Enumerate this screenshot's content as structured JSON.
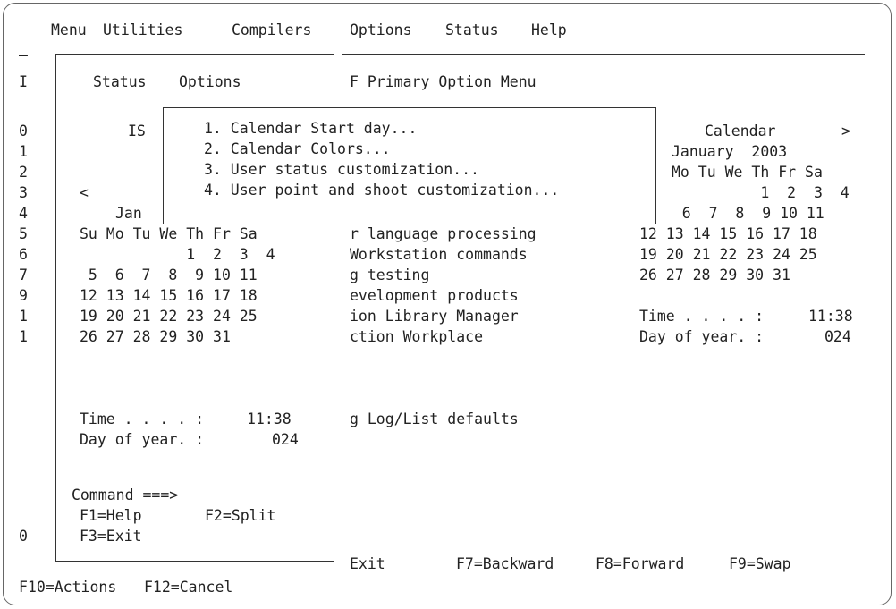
{
  "menubar": {
    "items": [
      "Menu",
      "Utilities",
      "Compilers",
      "Options",
      "Status",
      "Help"
    ]
  },
  "left_gutter": {
    "rows": [
      {
        "text": "—"
      },
      {
        "text": "I"
      },
      {
        "text": "0"
      },
      {
        "text": "1"
      },
      {
        "text": "2"
      },
      {
        "text": "3"
      },
      {
        "text": "4"
      },
      {
        "text": "5"
      },
      {
        "text": "6"
      },
      {
        "text": "7"
      },
      {
        "text": "9"
      },
      {
        "text": "1"
      },
      {
        "text": "1"
      },
      {
        "text": "0"
      }
    ]
  },
  "status_panel": {
    "menu_status": "Status",
    "menu_options": "Options",
    "is_text": "IS",
    "prev_arrow": "<",
    "month_abbrev": "Jan",
    "weekday_header": "Su Mo Tu We Th Fr Sa",
    "weeks": [
      "            1  2  3  4",
      " 5  6  7  8  9 10 11",
      "12 13 14 15 16 17 18",
      "19 20 21 22 23 24 25",
      "26 27 28 29 30 31"
    ],
    "time_label": "Time . . . . :",
    "time_value": "11:38",
    "doy_label": "Day of year. :",
    "doy_value": "024",
    "command_label": "Command ===>",
    "f1": "F1=Help",
    "f2": "F2=Split",
    "f3": "F3=Exit"
  },
  "options_popup": {
    "items": [
      "1. Calendar Start day...",
      "2. Calendar Colors...",
      "3. User status customization...",
      "4. User point and shoot customization..."
    ]
  },
  "primary_menu": {
    "title": "F Primary Option Menu",
    "items": [
      "r language processing",
      "Workstation commands",
      "g testing",
      "evelopment products",
      "ion Library Manager",
      "ction Workplace",
      "g Log/List defaults"
    ]
  },
  "right_calendar": {
    "title": "Calendar",
    "next_arrow": ">",
    "month_year": "January  2003",
    "weekday_header": "Mo Tu We Th Fr Sa",
    "weeks": [
      "          1  2  3  4",
      "   6  7  8  9 10 11",
      "12 13 14 15 16 17 18",
      "19 20 21 22 23 24 25",
      "26 27 28 29 30 31"
    ],
    "time_label": "Time . . . . :",
    "time_value": "11:38",
    "doy_label": "Day of year. :",
    "doy_value": "024"
  },
  "bottom_keys": {
    "exit": "Exit",
    "f7": "F7=Backward",
    "f8": "F8=Forward",
    "f9": "F9=Swap",
    "f10": "F10=Actions",
    "f12": "F12=Cancel"
  }
}
